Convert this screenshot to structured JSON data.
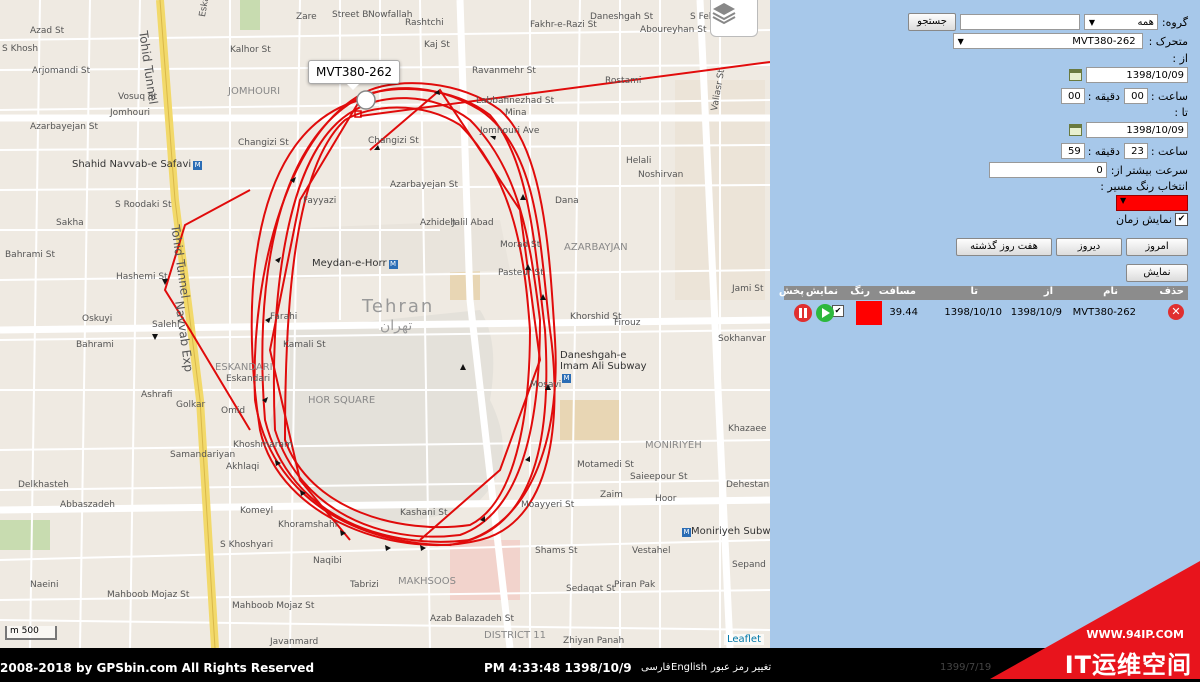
{
  "map": {
    "tooltip": "MVT380-262",
    "scale": "m 500",
    "attribution": "Leaflet",
    "city_label": "Tehran",
    "city_label_fa": "تهران",
    "streets": [
      "Azad St",
      "Tohid Tunnel",
      "Eskandari St",
      "Kalhor St",
      "Zare",
      "Street B",
      "Nowfallah",
      "Rashtchi",
      "Kaj St",
      "Ravanmehr St",
      "Fakhr-e-Razi St",
      "Daneshgah St",
      "Aboureyhan St",
      "S Felestin St",
      "S Khosh",
      "Arjomandi St",
      "Vosuq St",
      "Jomhouri",
      "Jomhouri Ave",
      "Labbafinezhad St",
      "Mina",
      "Rostami",
      "Valiasr St",
      "Azarbayejan St",
      "Changizi St",
      "Changizi St",
      "Helali",
      "Noshirvan",
      "Fayyazi",
      "Azarbayejan St",
      "Azhideh",
      "Jalil Abad",
      "Dana",
      "Bahrami St",
      "Sakha",
      "Hashemi St",
      "S Roodaki St",
      "Tohid Tunnel",
      "Oskuyi",
      "Bahrami",
      "Salehi",
      "Navvab Exp",
      "Kamali St",
      "Farahi",
      "Khorshid St",
      "Firouz",
      "Pasteur St",
      "Jami St",
      "Sokhanvar",
      "Ashrafi",
      "Golkar",
      "Samandariyan",
      "Omid",
      "Khoshmaram",
      "Akhlaqi",
      "Delkhasteh",
      "Abbaszadeh",
      "Komeyl",
      "Khoramshahr",
      "Kashani St",
      "Moayyeri St",
      "Motamedi St",
      "Zaim",
      "Saieepour St",
      "Hoor",
      "Khazaee",
      "Dehestani",
      "Sepand",
      "Shams St",
      "Vestahel",
      "Mahboob Mojaz St",
      "Naqibi",
      "Mahboob Mojaz St",
      "Tabrizi",
      "Javanmard",
      "S Khoshyari",
      "Azab Balazadeh St",
      "Zhiyan Panah",
      "Piran Pak",
      "Sedaqat St",
      "Eskandari",
      "Mosavi",
      "Naeini",
      "Morad St"
    ],
    "districts": [
      "JOMHOURI",
      "AZARBAYJAN",
      "MONIRIYEH",
      "ESKANDARI",
      "HOR SQUARE",
      "MAKHSOOS",
      "DISTRICT 11"
    ],
    "metro": [
      "Shahid Navvab-e Safavi",
      "Meydan-e-Horr",
      "Daneshgah-e Imam Ali Subway",
      "Moniriyeh Subway"
    ]
  },
  "panel": {
    "group_label": "گروه:",
    "group_value": "همه",
    "search_button": "جستجو",
    "vehicle_label": "متحرک :",
    "vehicle_value": "MVT380-262",
    "from_label": "از :",
    "from_date": "1398/10/09",
    "hour_label": "ساعت :",
    "minute_label": "دقیقه :",
    "from_hour": "00",
    "from_minute": "00",
    "to_label": "تا :",
    "to_date": "1398/10/09",
    "to_hour": "23",
    "to_minute": "59",
    "speed_label": "سرعت بیشتر از:",
    "speed_value": "0",
    "color_label": "انتخاب رنگ مسیر :",
    "show_time_label": "نمایش زمان",
    "today_button": "امروز",
    "yesterday_button": "دیروز",
    "last_week_button": "هفت روز گذشته",
    "show_button": "نمایش",
    "route_color": "#ff0000"
  },
  "table": {
    "headers": {
      "delete": "حذف",
      "name": "نام",
      "from": "از",
      "to": "تا",
      "distance": "مسافت",
      "color": "رنگ",
      "show": "نمایش",
      "play": "پخش"
    },
    "row": {
      "name": "MVT380-262",
      "from": "1398/10/9",
      "to": "1398/10/10",
      "distance": "39.44"
    }
  },
  "footer": {
    "copyright": "2008-2018 by GPSbin.com All Rights Reserved",
    "datetime": "PM 4:33:48 1398/10/9",
    "lang_en": "English",
    "lang_fa": "فارسی",
    "change_password": "تغییر رمز عبور",
    "faint_date": "1399/7/19"
  },
  "watermark": {
    "url": "WWW.94IP.COM",
    "text": "IT运维空间"
  }
}
